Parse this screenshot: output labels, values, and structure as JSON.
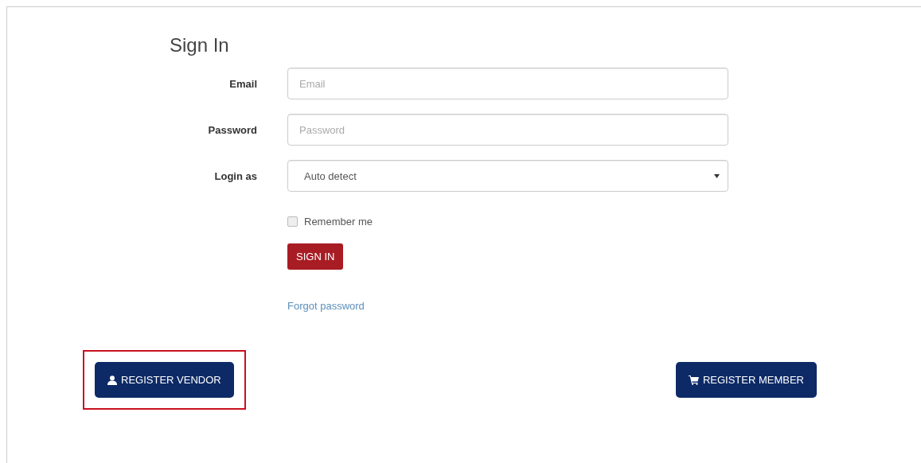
{
  "title": "Sign In",
  "fields": [
    {
      "kind": "text",
      "label": "Email",
      "placeholder": "Email"
    },
    {
      "kind": "password",
      "label": "Password",
      "placeholder": "Password"
    },
    {
      "kind": "select",
      "label": "Login as",
      "value": "Auto detect"
    }
  ],
  "remember": {
    "label": "Remember me",
    "checked": false
  },
  "sign_in_button": "SIGN IN",
  "forgot_link": "Forgot password",
  "register_buttons": [
    {
      "kind": "vendor",
      "label": "REGISTER VENDOR",
      "highlighted": true
    },
    {
      "kind": "member",
      "label": "REGISTER MEMBER",
      "highlighted": false
    }
  ]
}
